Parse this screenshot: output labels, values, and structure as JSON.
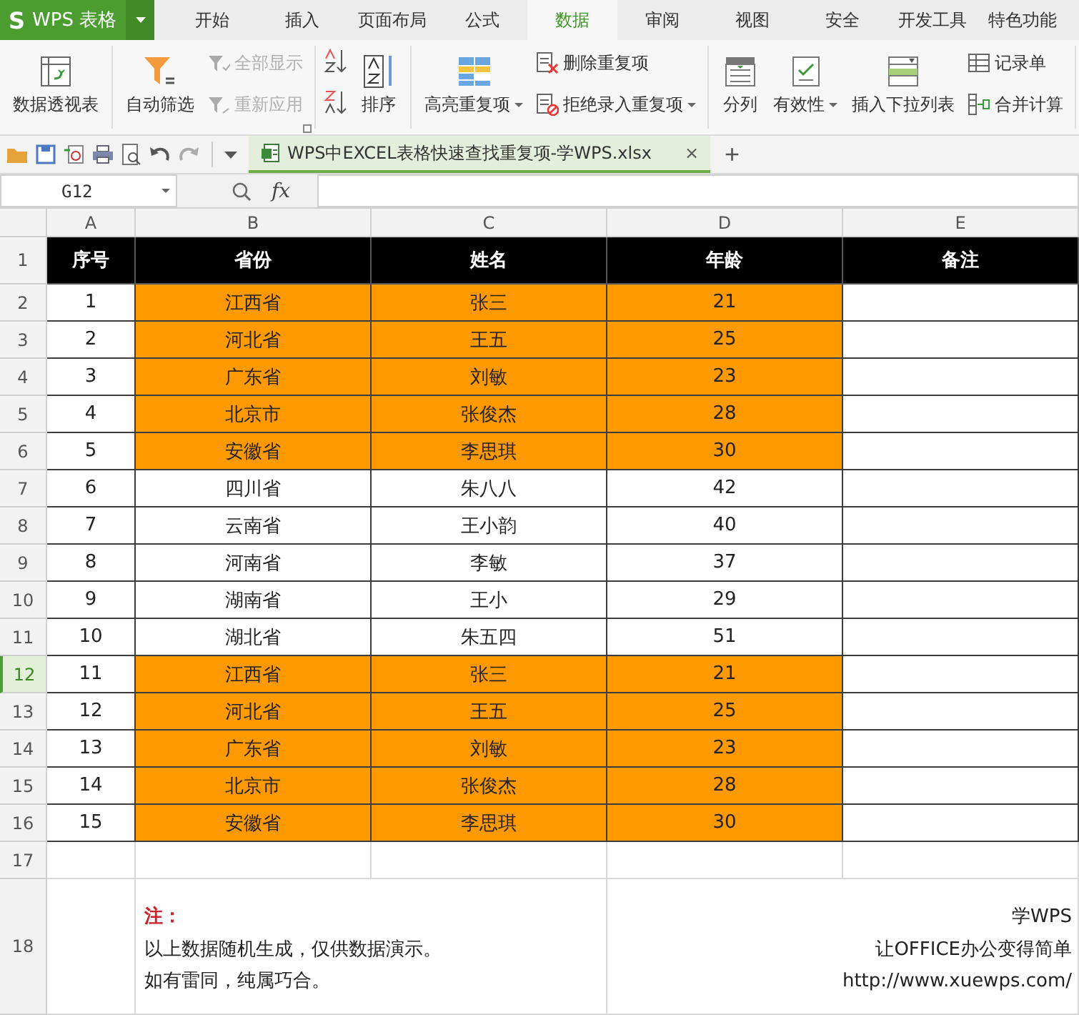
{
  "app": {
    "logo_mark": "S",
    "logo": "WPS 表格",
    "tabs": [
      {
        "label": "开始",
        "selected": false
      },
      {
        "label": "插入",
        "selected": false
      },
      {
        "label": "页面布局",
        "selected": false
      },
      {
        "label": "公式",
        "selected": false
      },
      {
        "label": "数据",
        "selected": true
      },
      {
        "label": "审阅",
        "selected": false
      },
      {
        "label": "视图",
        "selected": false
      },
      {
        "label": "安全",
        "selected": false
      },
      {
        "label": "开发工具",
        "selected": false
      },
      {
        "label": "特色功能",
        "selected": false
      }
    ]
  },
  "ribbon": {
    "groups": [
      {
        "items": [
          {
            "kind": "large",
            "label": "数据透视表",
            "dropdown": false,
            "disabled": false
          }
        ]
      },
      {
        "items": [
          {
            "kind": "large",
            "label": "自动筛选",
            "dropdown": false,
            "disabled": false
          },
          {
            "kind": "stack",
            "launcher": true,
            "items": [
              {
                "label": "全部显示",
                "dropdown": false,
                "disabled": true
              },
              {
                "label": "重新应用",
                "dropdown": false,
                "disabled": true
              }
            ]
          }
        ]
      },
      {
        "items": [
          {
            "kind": "icon-stack",
            "items": [
              {
                "disabled": false
              },
              {
                "disabled": false
              }
            ]
          },
          {
            "kind": "large",
            "label": "排序",
            "dropdown": false,
            "disabled": false
          }
        ]
      },
      {
        "items": [
          {
            "kind": "large",
            "label": "高亮重复项",
            "dropdown": true,
            "disabled": false
          },
          {
            "kind": "stack",
            "launcher": false,
            "items": [
              {
                "label": "删除重复项",
                "dropdown": false,
                "disabled": false
              },
              {
                "label": "拒绝录入重复项",
                "dropdown": true,
                "disabled": false
              }
            ]
          }
        ]
      },
      {
        "items": [
          {
            "kind": "large",
            "label": "分列",
            "dropdown": false,
            "disabled": false
          },
          {
            "kind": "large",
            "label": "有效性",
            "dropdown": true,
            "disabled": false
          },
          {
            "kind": "large",
            "label": "插入下拉列表",
            "dropdown": false,
            "disabled": false
          },
          {
            "kind": "stack",
            "launcher": false,
            "items": [
              {
                "label": "记录单",
                "dropdown": false,
                "disabled": false
              },
              {
                "label": "合并计算",
                "dropdown": false,
                "disabled": false
              }
            ]
          }
        ]
      }
    ]
  },
  "document_tab": {
    "title": "WPS中EXCEL表格快速查找重复项-学WPS.xlsx",
    "close": "×",
    "new_tab": "+"
  },
  "formula_bar": {
    "name_box": "G12",
    "fx": "fx"
  },
  "sheet": {
    "columns": [
      "A",
      "B",
      "C",
      "D",
      "E"
    ],
    "header": {
      "number": "1",
      "cells": [
        "序号",
        "省份",
        "姓名",
        "年龄",
        "备注"
      ]
    },
    "rows": [
      {
        "number": "2",
        "selected": false,
        "highlighted": true,
        "cells": [
          "1",
          "江西省",
          "张三",
          "21"
        ]
      },
      {
        "number": "3",
        "selected": false,
        "highlighted": true,
        "cells": [
          "2",
          "河北省",
          "王五",
          "25"
        ]
      },
      {
        "number": "4",
        "selected": false,
        "highlighted": true,
        "cells": [
          "3",
          "广东省",
          "刘敏",
          "23"
        ]
      },
      {
        "number": "5",
        "selected": false,
        "highlighted": true,
        "cells": [
          "4",
          "北京市",
          "张俊杰",
          "28"
        ]
      },
      {
        "number": "6",
        "selected": false,
        "highlighted": true,
        "cells": [
          "5",
          "安徽省",
          "李思琪",
          "30"
        ]
      },
      {
        "number": "7",
        "selected": false,
        "highlighted": false,
        "cells": [
          "6",
          "四川省",
          "朱八八",
          "42"
        ]
      },
      {
        "number": "8",
        "selected": false,
        "highlighted": false,
        "cells": [
          "7",
          "云南省",
          "王小韵",
          "40"
        ]
      },
      {
        "number": "9",
        "selected": false,
        "highlighted": false,
        "cells": [
          "8",
          "河南省",
          "李敏",
          "37"
        ]
      },
      {
        "number": "10",
        "selected": false,
        "highlighted": false,
        "cells": [
          "9",
          "湖南省",
          "王小",
          "29"
        ]
      },
      {
        "number": "11",
        "selected": false,
        "highlighted": false,
        "cells": [
          "10",
          "湖北省",
          "朱五四",
          "51"
        ]
      },
      {
        "number": "12",
        "selected": true,
        "highlighted": true,
        "cells": [
          "11",
          "江西省",
          "张三",
          "21"
        ]
      },
      {
        "number": "13",
        "selected": false,
        "highlighted": true,
        "cells": [
          "12",
          "河北省",
          "王五",
          "25"
        ]
      },
      {
        "number": "14",
        "selected": false,
        "highlighted": true,
        "cells": [
          "13",
          "广东省",
          "刘敏",
          "23"
        ]
      },
      {
        "number": "15",
        "selected": false,
        "highlighted": true,
        "cells": [
          "14",
          "北京市",
          "张俊杰",
          "28"
        ]
      },
      {
        "number": "16",
        "selected": false,
        "highlighted": true,
        "cells": [
          "15",
          "安徽省",
          "李思琪",
          "30"
        ]
      }
    ],
    "empty_row": {
      "number": "17",
      "selected": false
    },
    "note": {
      "number": "18",
      "selected": false,
      "title": "注：",
      "lines": [
        "以上数据随机生成，仅供数据演示。",
        "如有雷同，纯属巧合。"
      ],
      "credit": [
        "学WPS",
        "让OFFICE办公变得简单",
        "http://www.xuewps.com/"
      ]
    }
  }
}
